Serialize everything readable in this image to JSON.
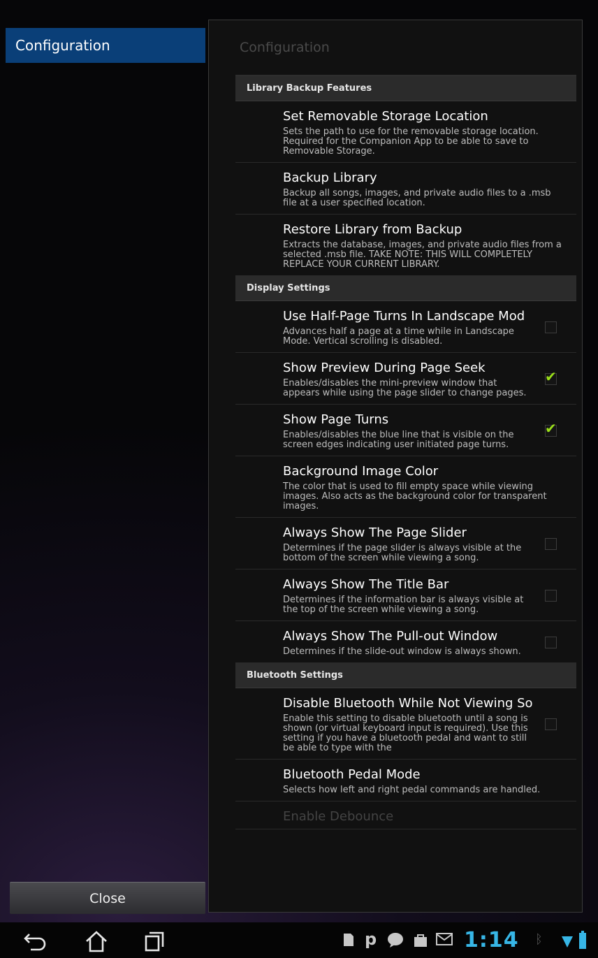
{
  "left": {
    "item": "Configuration",
    "close_label": "Close"
  },
  "panel": {
    "title": "Configuration"
  },
  "sections": {
    "backup": {
      "header": "Library Backup Features",
      "items": [
        {
          "title": "Set Removable Storage Location",
          "summary": "Sets the path to use for the removable storage location. Required for the Companion App to be able to save to Removable Storage."
        },
        {
          "title": "Backup Library",
          "summary": "Backup all songs, images, and private audio files to a .msb file at a user specified location."
        },
        {
          "title": "Restore Library from Backup",
          "summary": "Extracts the database, images, and private audio files from a selected .msb file. TAKE NOTE: THIS WILL COMPLETELY REPLACE YOUR CURRENT LIBRARY."
        }
      ]
    },
    "display": {
      "header": "Display Settings",
      "items": [
        {
          "title": "Use Half-Page Turns In Landscape Mod",
          "summary": "Advances half a page at a time while in Landscape Mode. Vertical scrolling is disabled.",
          "checked": false
        },
        {
          "title": "Show Preview During Page Seek",
          "summary": "Enables/disables the mini-preview window that appears while using the page slider to change pages.",
          "checked": true
        },
        {
          "title": "Show Page Turns",
          "summary": "Enables/disables the blue line that is visible on the screen edges indicating user initiated page turns.",
          "checked": true
        },
        {
          "title": "Background Image Color",
          "summary": "The color that is used to fill empty space while viewing images. Also acts as the background color for transparent images."
        },
        {
          "title": "Always Show The Page Slider",
          "summary": "Determines if the page slider is always visible at the bottom of the screen while viewing a song.",
          "checked": false
        },
        {
          "title": "Always Show The Title Bar",
          "summary": "Determines if the information bar is always visible at the top of the screen while viewing a song.",
          "checked": false
        },
        {
          "title": "Always Show The Pull-out Window",
          "summary": "Determines if the slide-out window is always shown.",
          "checked": false
        }
      ]
    },
    "bluetooth": {
      "header": "Bluetooth Settings",
      "items": [
        {
          "title": "Disable Bluetooth While Not Viewing So",
          "summary": "Enable this setting to disable bluetooth until a song is shown (or virtual keyboard input is required). Use this setting if you have a bluetooth pedal and want to still be able to type with the",
          "checked": false
        },
        {
          "title": "Bluetooth Pedal Mode",
          "summary": "Selects how left and right pedal commands are handled."
        },
        {
          "title": "Enable Debounce"
        }
      ]
    }
  },
  "navbar": {
    "clock": "1:14",
    "status_icons": [
      "sd-card-icon",
      "p-icon",
      "talk-icon",
      "bag-icon",
      "gmail-icon",
      "bluetooth-icon",
      "wifi-icon",
      "battery-icon"
    ]
  },
  "colors": {
    "accent_blue": "#0a3f78",
    "check_green": "#9be01a",
    "clock_blue": "#37b6e6"
  }
}
